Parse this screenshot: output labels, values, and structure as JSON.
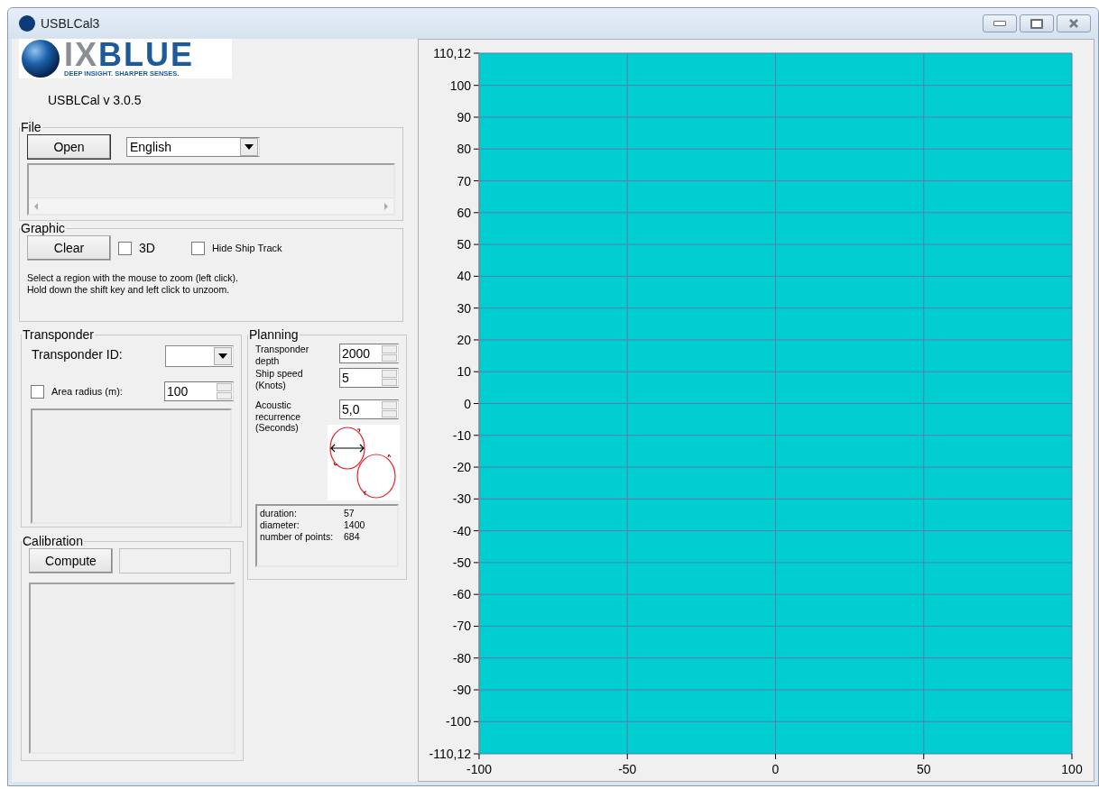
{
  "window": {
    "title": "USBLCal3"
  },
  "logo": {
    "part_1": "IX",
    "part_2": "BLUE",
    "tagline": "DEEP INSIGHT. SHARPER SENSES."
  },
  "version": "USBLCal v 3.0.5",
  "file": {
    "title": "File",
    "open_button": "Open",
    "language": "English"
  },
  "graphic": {
    "title": "Graphic",
    "clear_button": "Clear",
    "options": [
      {
        "label": "3D",
        "checked": false
      },
      {
        "label": "Hide Ship Track",
        "checked": false
      }
    ],
    "help_lines": [
      "Select a region with the mouse to zoom (left click).",
      "Hold down the shift key and left click to unzoom."
    ]
  },
  "transponder": {
    "title": "Transponder",
    "id_label": "Transponder ID:",
    "area_label": "Area radius (m):",
    "area_checked": false,
    "area_value": "100"
  },
  "planning": {
    "title": "Planning",
    "fields": [
      {
        "label_lines": [
          "Transponder",
          "depth"
        ],
        "value": "2000"
      },
      {
        "label_lines": [
          "Ship speed",
          "(Knots)"
        ],
        "value": "5"
      },
      {
        "label_lines": [
          "Acoustic",
          "recurrence",
          "(Seconds)"
        ],
        "value": "5,0"
      }
    ],
    "results": [
      {
        "name": "duration:",
        "value": "57"
      },
      {
        "name": "diameter:",
        "value": "1400"
      },
      {
        "name": "number of points:",
        "value": "684"
      }
    ]
  },
  "calibration": {
    "title": "Calibration",
    "compute_button": "Compute"
  },
  "chart_data": {
    "type": "line",
    "grid": true,
    "xlim": [
      -100,
      100
    ],
    "ylim": [
      -110.12,
      110.12
    ],
    "xticks": [
      -100,
      -50,
      0,
      50,
      100
    ],
    "yticks": [
      {
        "value": 110.12,
        "label": "110,12"
      },
      100,
      90,
      80,
      70,
      60,
      50,
      40,
      30,
      20,
      10,
      0,
      -10,
      -20,
      -30,
      -40,
      -50,
      -60,
      -70,
      -80,
      -90,
      -100,
      {
        "value": -110.12,
        "label": "-110,12"
      }
    ]
  }
}
